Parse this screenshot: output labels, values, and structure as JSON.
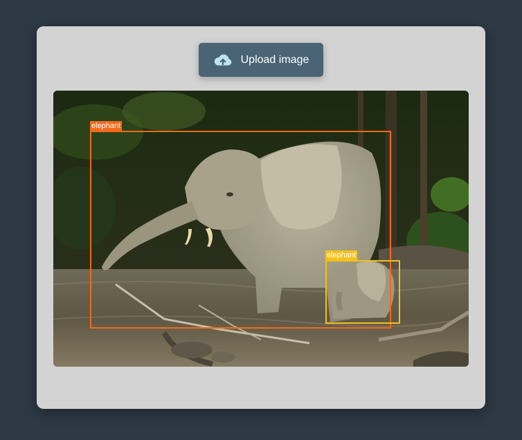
{
  "upload": {
    "label": "Upload image",
    "icon": "cloud-upload-icon"
  },
  "image": {
    "description_icon": "photo",
    "detections": [
      {
        "label": "elephant",
        "color": "#f26a1b"
      },
      {
        "label": "elephant",
        "color": "#f2c21b"
      }
    ]
  },
  "colors": {
    "page_bg": "#2e3946",
    "card_bg": "#d3d3d3",
    "button_bg": "#4a6475",
    "icon_color": "#bfe3f5"
  }
}
